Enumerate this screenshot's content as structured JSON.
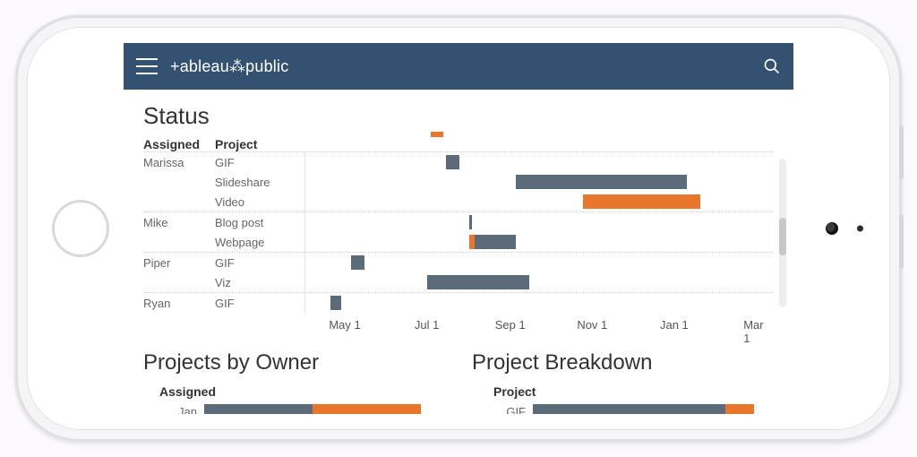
{
  "header": {
    "logo": "+ableau⁂public"
  },
  "colors": {
    "bar_primary": "#5b6b7a",
    "bar_accent": "#e8762c",
    "header_bg": "#335170"
  },
  "status": {
    "title": "Status",
    "headers": {
      "assigned": "Assigned",
      "project": "Project"
    },
    "x_axis": {
      "ticks": [
        "May 1",
        "Jul 1",
        "Sep 1",
        "Nov 1",
        "Jan 1",
        "Mar 1"
      ],
      "range": [
        "Apr 1",
        "Mar 15"
      ]
    },
    "groups": [
      {
        "assigned": "Marissa",
        "rows": [
          {
            "project": "GIF",
            "bars": [
              {
                "start": "Jul 15",
                "end": "Jul 25",
                "color": "grey"
              }
            ]
          },
          {
            "project": "Slideshare",
            "bars": [
              {
                "start": "Sep 5",
                "end": "Jan 10",
                "color": "grey"
              }
            ]
          },
          {
            "project": "Video",
            "bars": [
              {
                "start": "Oct 25",
                "end": "Jan 20",
                "color": "orange"
              }
            ]
          }
        ]
      },
      {
        "assigned": "Mike",
        "rows": [
          {
            "project": "Blog post",
            "bars": [
              {
                "start": "Aug 1",
                "end": "Aug 3",
                "color": "grey"
              }
            ]
          },
          {
            "project": "Webpage",
            "bars": [
              {
                "start": "Aug 5",
                "end": "Sep 5",
                "color": "grey"
              },
              {
                "start": "Aug 1",
                "end": "Aug 5",
                "color": "orange"
              }
            ]
          }
        ]
      },
      {
        "assigned": "Piper",
        "rows": [
          {
            "project": "GIF",
            "bars": [
              {
                "start": "May 5",
                "end": "May 15",
                "color": "grey"
              }
            ]
          },
          {
            "project": "Viz",
            "bars": [
              {
                "start": "Jul 1",
                "end": "Sep 15",
                "color": "grey"
              }
            ]
          }
        ]
      },
      {
        "assigned": "Ryan",
        "rows": [
          {
            "project": "GIF",
            "bars": [
              {
                "start": "Apr 20",
                "end": "Apr 28",
                "color": "grey"
              }
            ]
          }
        ]
      }
    ]
  },
  "owner_chart": {
    "title": "Projects by Owner",
    "header": "Assigned",
    "rows": [
      {
        "label": "Jan",
        "segments": [
          {
            "value": 45,
            "color": "grey"
          },
          {
            "value": 45,
            "color": "orange"
          }
        ]
      }
    ]
  },
  "breakdown_chart": {
    "title": "Project Breakdown",
    "header": "Project",
    "rows": [
      {
        "label": "GIF",
        "segments": [
          {
            "value": 80,
            "color": "grey"
          },
          {
            "value": 12,
            "color": "orange"
          }
        ]
      }
    ]
  },
  "chart_data": [
    {
      "type": "bar",
      "name": "Status (Gantt)",
      "title": "Status",
      "x_type": "date",
      "x_range": [
        "2016-04-01",
        "2017-03-15"
      ],
      "x_ticks": [
        "May 1",
        "Jul 1",
        "Sep 1",
        "Nov 1",
        "Jan 1",
        "Mar 1"
      ],
      "columns": [
        "Assigned",
        "Project"
      ],
      "series": [
        {
          "assigned": "Marissa",
          "project": "GIF",
          "start": "2016-07-15",
          "end": "2016-07-25",
          "status": "grey"
        },
        {
          "assigned": "Marissa",
          "project": "Slideshare",
          "start": "2016-09-05",
          "end": "2017-01-10",
          "status": "grey"
        },
        {
          "assigned": "Marissa",
          "project": "Video",
          "start": "2016-10-25",
          "end": "2017-01-20",
          "status": "orange"
        },
        {
          "assigned": "Mike",
          "project": "Blog post",
          "start": "2016-08-01",
          "end": "2016-08-03",
          "status": "grey"
        },
        {
          "assigned": "Mike",
          "project": "Webpage",
          "start": "2016-08-05",
          "end": "2016-09-05",
          "status": "grey"
        },
        {
          "assigned": "Mike",
          "project": "Webpage",
          "start": "2016-08-01",
          "end": "2016-08-05",
          "status": "orange"
        },
        {
          "assigned": "Piper",
          "project": "GIF",
          "start": "2016-05-05",
          "end": "2016-05-15",
          "status": "grey"
        },
        {
          "assigned": "Piper",
          "project": "Viz",
          "start": "2016-07-01",
          "end": "2016-09-15",
          "status": "grey"
        },
        {
          "assigned": "Ryan",
          "project": "GIF",
          "start": "2016-04-20",
          "end": "2016-04-28",
          "status": "grey"
        }
      ]
    },
    {
      "type": "bar",
      "name": "Projects by Owner",
      "title": "Projects by Owner",
      "orientation": "horizontal",
      "stacked": true,
      "categories": [
        "Jan"
      ],
      "series": [
        {
          "name": "grey",
          "values": [
            45
          ]
        },
        {
          "name": "orange",
          "values": [
            45
          ]
        }
      ]
    },
    {
      "type": "bar",
      "name": "Project Breakdown",
      "title": "Project Breakdown",
      "orientation": "horizontal",
      "stacked": true,
      "categories": [
        "GIF"
      ],
      "series": [
        {
          "name": "grey",
          "values": [
            80
          ]
        },
        {
          "name": "orange",
          "values": [
            12
          ]
        }
      ]
    }
  ]
}
